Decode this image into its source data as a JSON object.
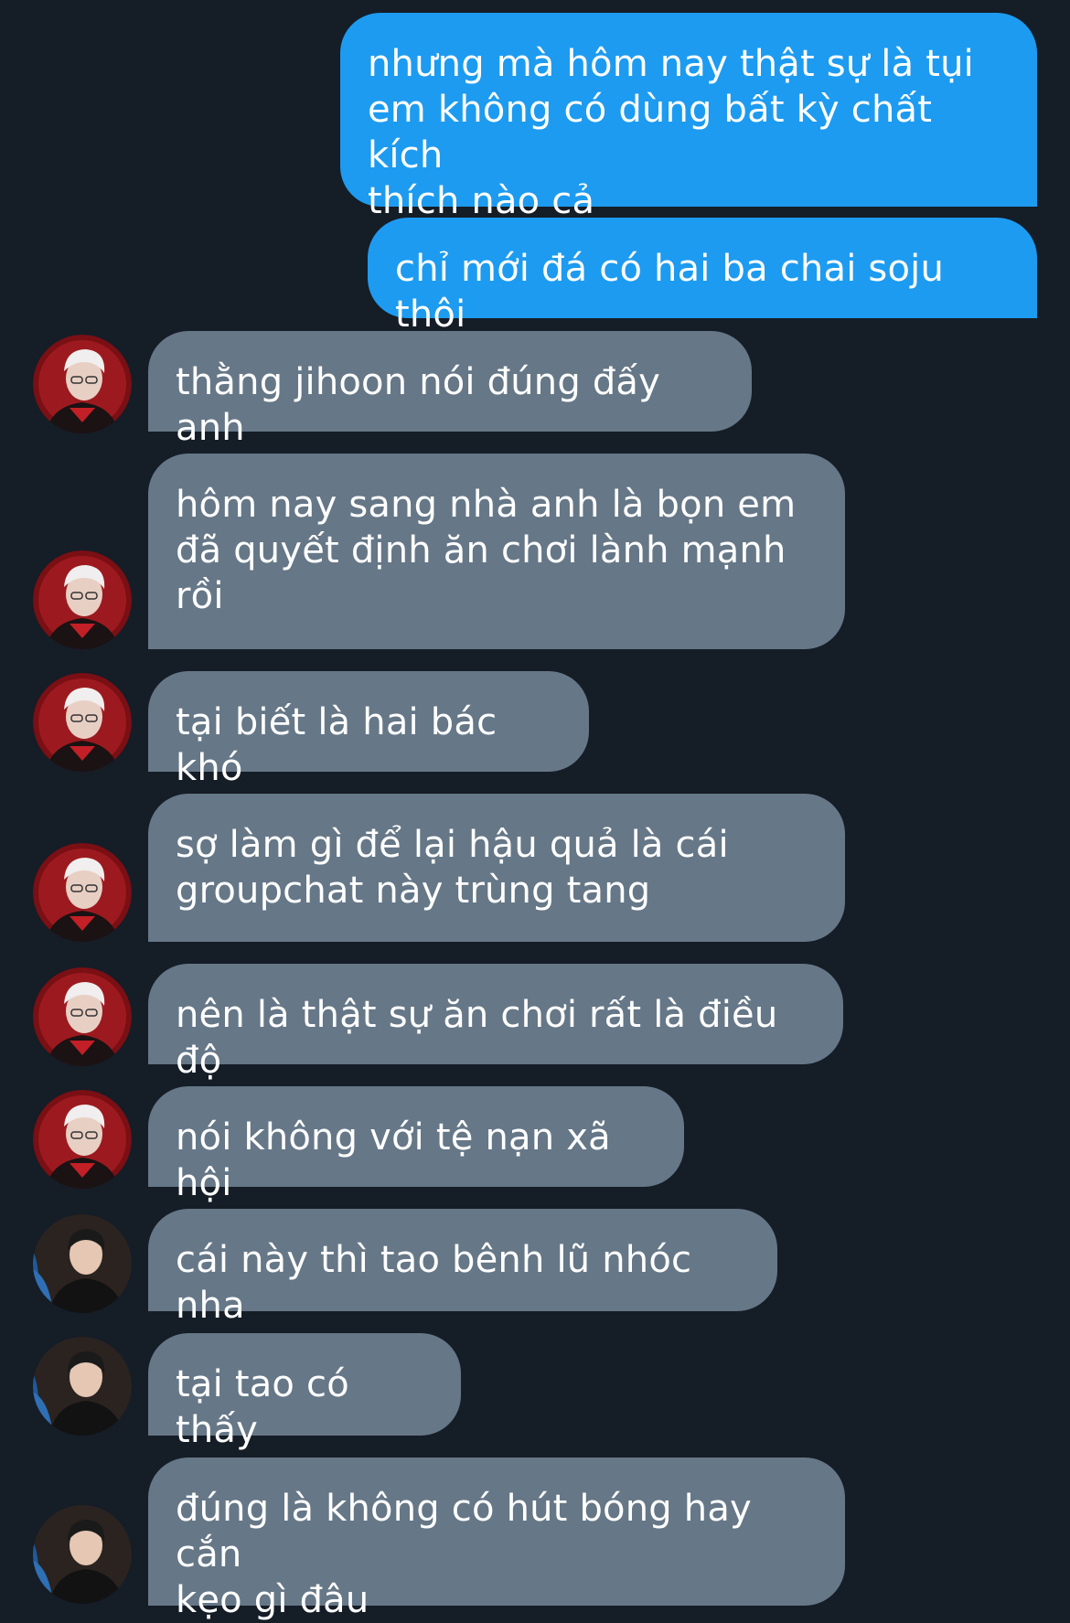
{
  "conversation": {
    "messages": [
      {
        "side": "out",
        "text": "nhưng mà hôm nay thật sự là tụi\nem không có dùng bất kỳ chất kích\nthích nào cả"
      },
      {
        "side": "out",
        "text": "chỉ mới đá có hai ba chai soju thôi"
      },
      {
        "side": "in",
        "avatar": "avatar-red-jersey-player",
        "text": "thằng jihoon nói đúng đấy anh"
      },
      {
        "side": "in",
        "avatar": "avatar-red-jersey-player",
        "text": "hôm nay sang nhà anh là bọn em\nđã quyết định ăn chơi lành mạnh\nrồi"
      },
      {
        "side": "in",
        "avatar": "avatar-red-jersey-player",
        "text": "tại biết là hai bác khó"
      },
      {
        "side": "in",
        "avatar": "avatar-red-jersey-player",
        "text": "sợ làm gì để lại hậu quả là cái\ngroupchat này trùng tang"
      },
      {
        "side": "in",
        "avatar": "avatar-red-jersey-player",
        "text": "nên là thật sự ăn chơi rất là điều độ"
      },
      {
        "side": "in",
        "avatar": "avatar-red-jersey-player",
        "text": "nói không với tệ nạn xã hội"
      },
      {
        "side": "in",
        "avatar": "avatar-dark-jacket-man",
        "text": "cái này thì tao bênh lũ nhóc nha"
      },
      {
        "side": "in",
        "avatar": "avatar-dark-jacket-man",
        "text": "tại tao có thấy"
      },
      {
        "side": "in",
        "avatar": "avatar-dark-jacket-man",
        "text": "đúng là không có hút bóng hay cắn\nkẹo gì đâu"
      }
    ]
  },
  "colors": {
    "background": "#151d27",
    "outgoing_bubble": "#1d9bf0",
    "incoming_bubble": "#667787",
    "text": "#ffffff"
  }
}
